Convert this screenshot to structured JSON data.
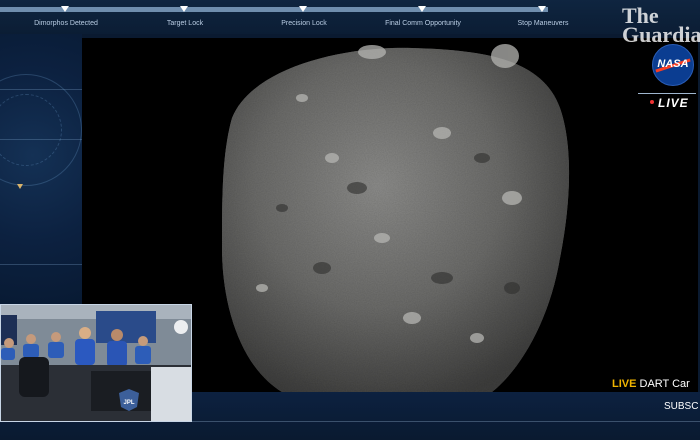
{
  "progress": {
    "milestones": [
      {
        "label": "Dimorphos Detected"
      },
      {
        "label": "Target Lock"
      },
      {
        "label": "Precision Lock"
      },
      {
        "label": "Final Comm Opportunity"
      },
      {
        "label": "Stop Maneuvers"
      }
    ]
  },
  "branding": {
    "guardian_line1": "The",
    "guardian_line2": "Guardian",
    "nasa": "NASA",
    "live": "LIVE"
  },
  "caption": {
    "live": "LIVE",
    "text": "DART Car"
  },
  "subscribe": "SUBSC",
  "inset": {
    "badge": "JPL"
  },
  "colors": {
    "background": "#0a1a30",
    "accent_live": "#f0b400",
    "nasa_blue": "#0b3d91",
    "nasa_red": "#fc3d21"
  }
}
